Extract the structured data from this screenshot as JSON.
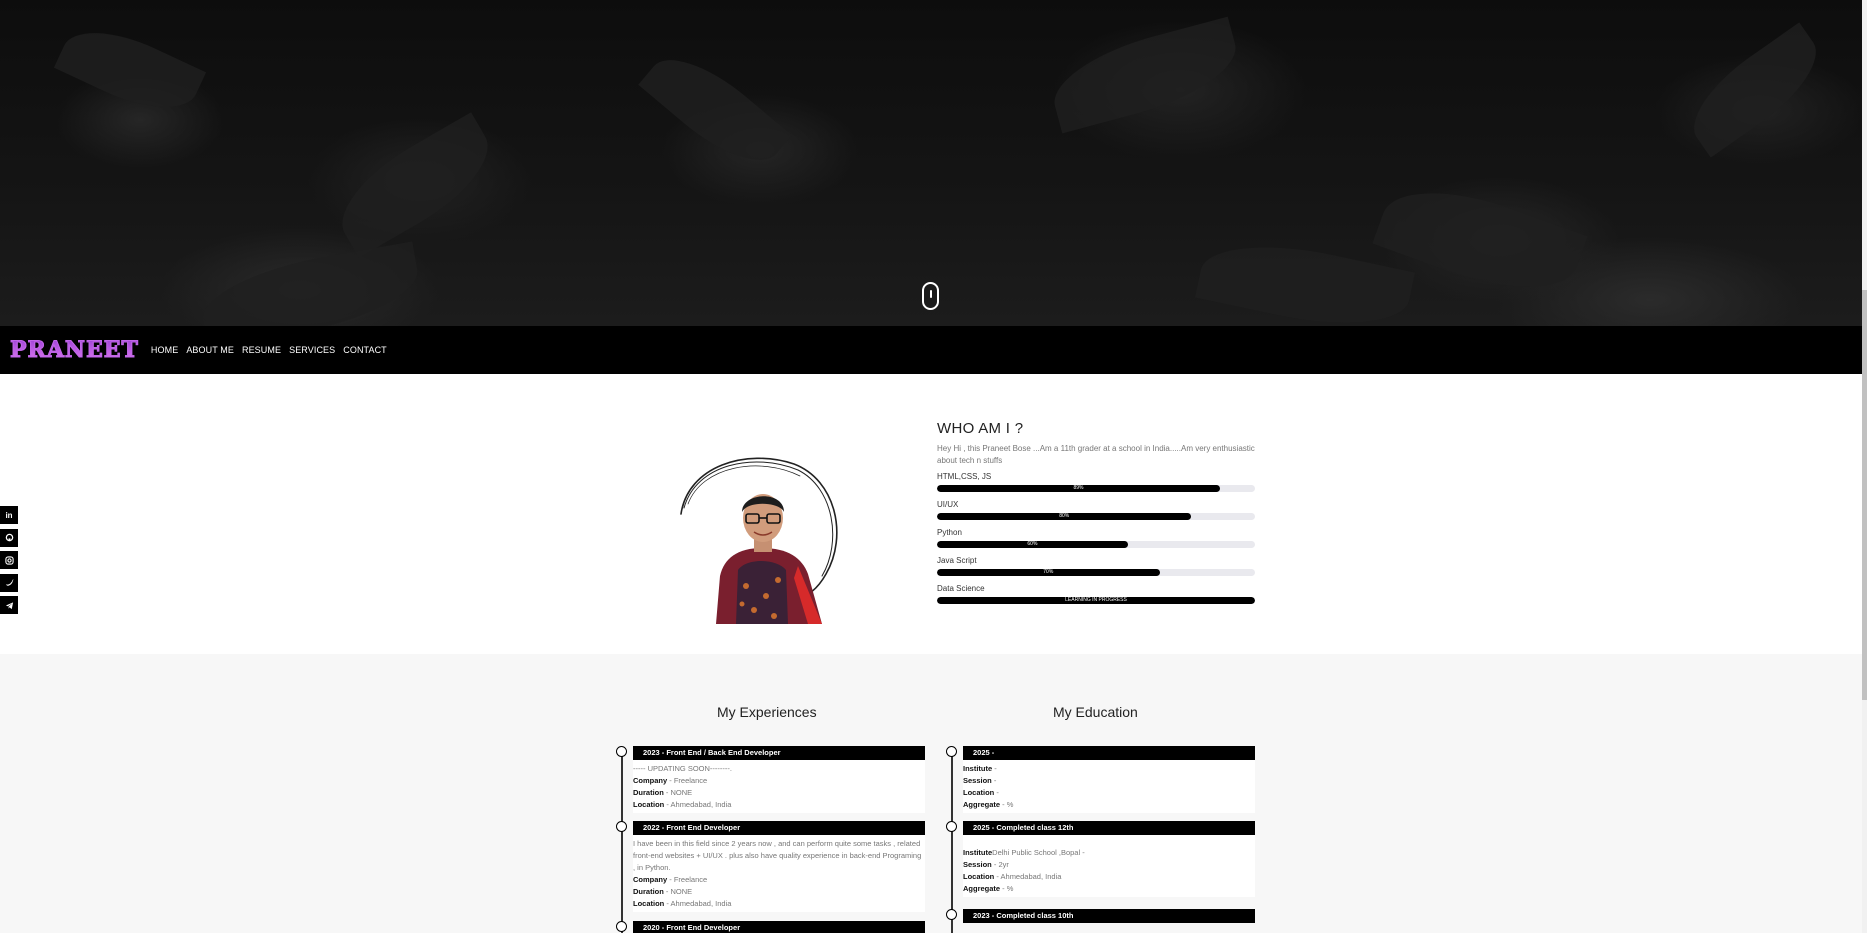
{
  "nav": {
    "logo": "PRANEET",
    "links": [
      "HOME",
      "ABOUT ME",
      "RESUME",
      "SERVICES",
      "CONTACT"
    ]
  },
  "social": [
    "in",
    "gh",
    "ig",
    "tw",
    "tg"
  ],
  "social_icons": [
    "linkedin-icon",
    "github-icon",
    "instagram-icon",
    "twitter-icon",
    "telegram-icon"
  ],
  "about": {
    "title": "WHO AM I ?",
    "intro": "Hey Hi , this Praneet Bose ...Am a 11th grader at a school in India.....Am very enthusiastic about tech n stuffs",
    "skills": [
      {
        "label": "HTML,CSS, JS",
        "percent": 89,
        "text": "89%"
      },
      {
        "label": "UI/UX",
        "percent": 80,
        "text": "80%"
      },
      {
        "label": "Python",
        "percent": 60,
        "text": "60%"
      },
      {
        "label": "Java Script",
        "percent": 70,
        "text": "70%"
      },
      {
        "label": "Data Science",
        "percent": 100,
        "text": "LEARNING IN PROGRESS"
      }
    ]
  },
  "experience": {
    "title": "My Experiences",
    "entries": [
      {
        "head": "2023 - Front End / Back End Developer",
        "desc": "----- UPDATING SOON--------.",
        "company": "Freelance",
        "duration": "NONE",
        "location": "Ahmedabad, India"
      },
      {
        "head": "2022 - Front End Developer",
        "desc": "I have been in this field since 2 years now , and can perform quite some tasks , related front-end websites + UI/UX . plus also have quality experience in back-end Programing , in Python.",
        "company": "Freelance",
        "duration": "NONE",
        "location": "Ahmedabad, India"
      },
      {
        "head": "2020 - Front End Developer"
      }
    ]
  },
  "education": {
    "title": "My Education",
    "entries": [
      {
        "head": "2025 -",
        "institute": "",
        "session": "",
        "location": "",
        "aggregate": "%"
      },
      {
        "head": "2025 - Completed class 12th",
        "institute": "Delhi Public School ,Bopal -",
        "session": "2yr",
        "location": "Ahmedabad, India",
        "aggregate": "%"
      },
      {
        "head": "2023 - Completed class 10th"
      }
    ]
  },
  "labels": {
    "company": "Company",
    "duration": "Duration",
    "location": "Location",
    "institute": "Institute",
    "session": "Session",
    "aggregate": "Aggregate"
  }
}
